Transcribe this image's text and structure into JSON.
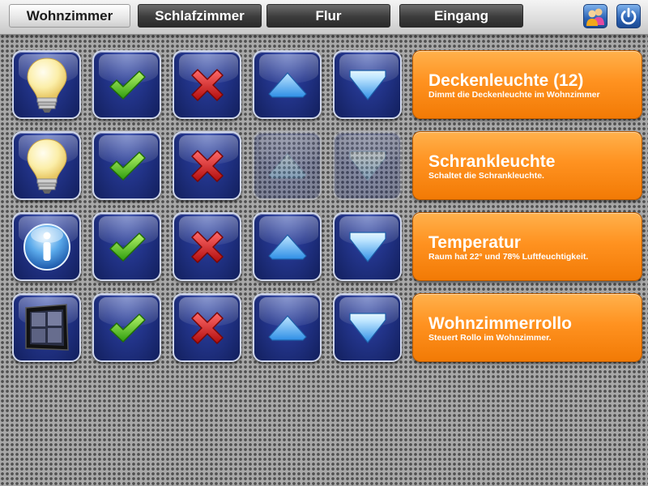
{
  "tabs": [
    {
      "label": "Wohnzimmer",
      "active": true
    },
    {
      "label": "Schlafzimmer",
      "active": false
    },
    {
      "label": "Flur",
      "active": false
    },
    {
      "label": "Eingang",
      "active": false
    }
  ],
  "toolbar": {
    "users_icon": "users-icon",
    "power_icon": "power-icon"
  },
  "devices": [
    {
      "icon": "light-bulb-icon",
      "title": "Deckenleuchte (12)",
      "subtitle": "Dimmt die Deckenleuchte im Wohnzimmer",
      "up_enabled": true,
      "down_enabled": true
    },
    {
      "icon": "light-bulb-icon",
      "title": "Schrankleuchte",
      "subtitle": "Schaltet die Schrankleuchte.",
      "up_enabled": false,
      "down_enabled": false
    },
    {
      "icon": "info-icon",
      "title": "Temperatur",
      "subtitle": "Raum hat 22° und 78% Luftfeuchtigkeit.",
      "up_enabled": true,
      "down_enabled": true
    },
    {
      "icon": "window-icon",
      "title": "Wohnzimmerrollo",
      "subtitle": "Steuert Rollo im Wohnzimmer.",
      "up_enabled": true,
      "down_enabled": true
    }
  ],
  "colors": {
    "accent_orange": "#ff9220",
    "button_blue": "#24368e",
    "check_green": "#4cc61c",
    "cross_red": "#e01b1b",
    "arrow_blue": "#4aa8f0"
  }
}
